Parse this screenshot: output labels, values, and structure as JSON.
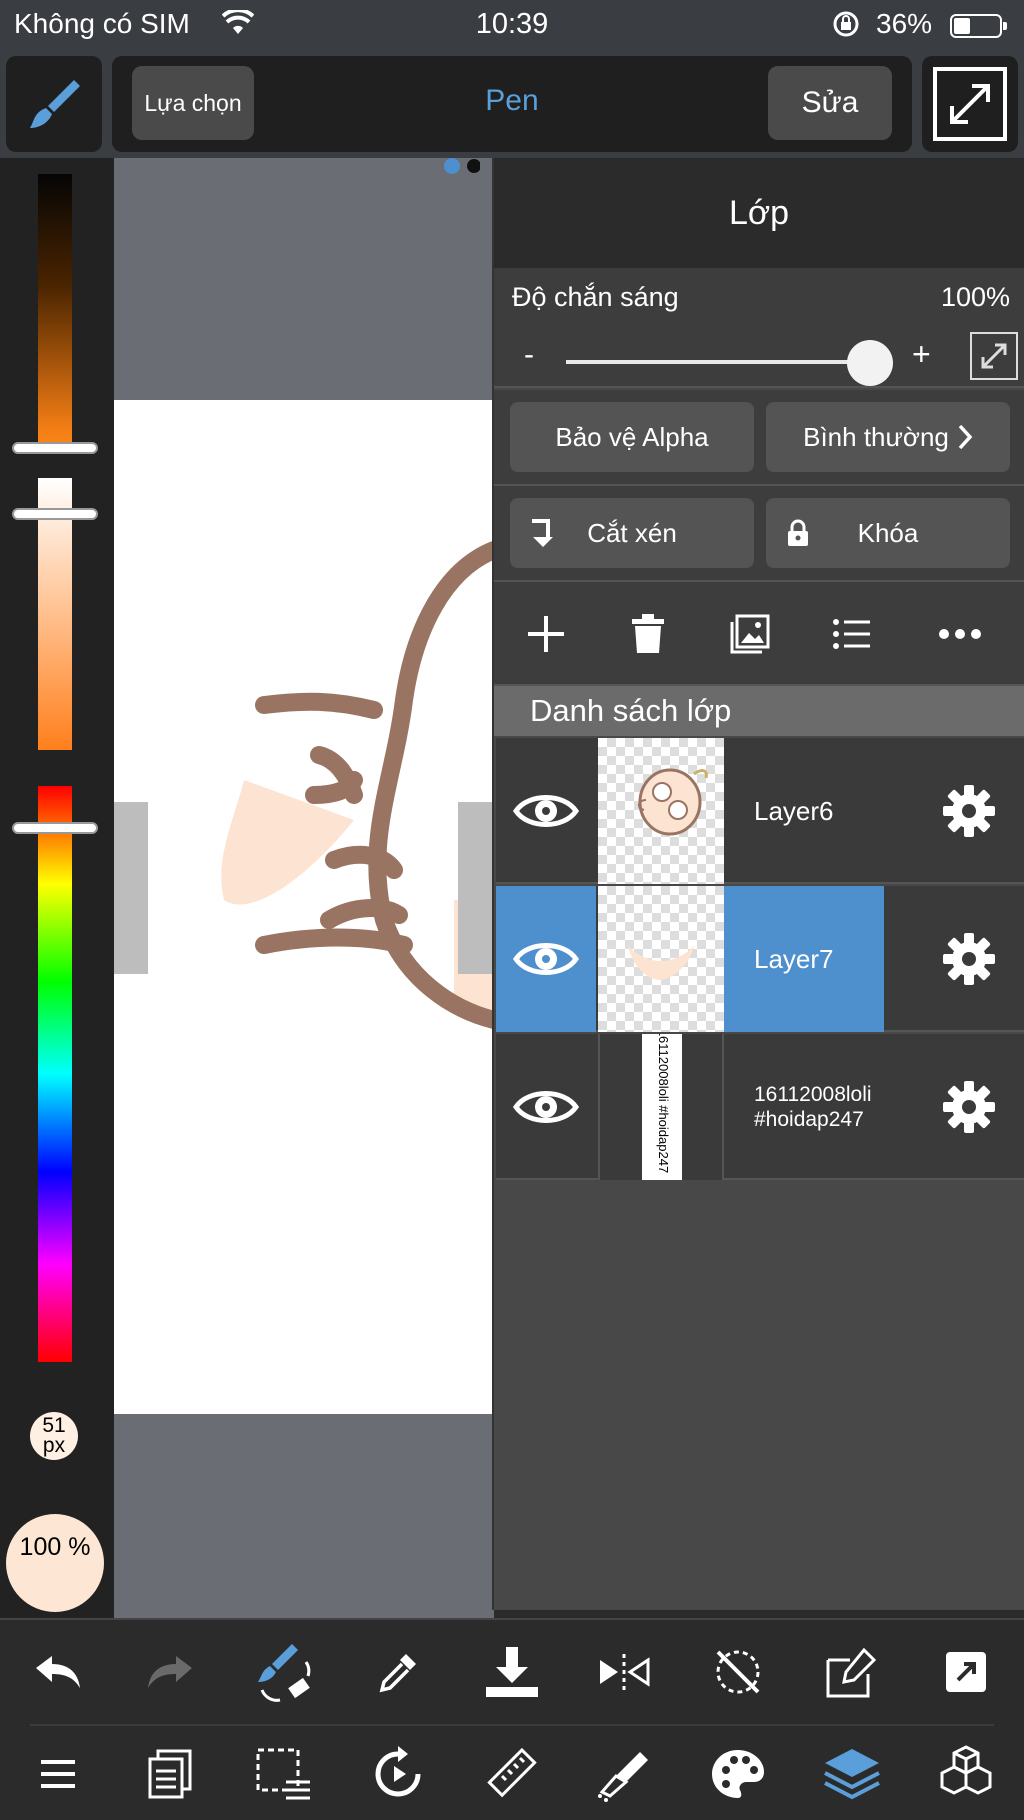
{
  "status_bar": {
    "carrier": "Không có SIM",
    "time": "10:39",
    "battery": "36%",
    "battery_level": 0.36
  },
  "toolbar": {
    "select_label": "Lựa chọn",
    "tool_name": "Pen",
    "edit_label": "Sửa"
  },
  "left_panel": {
    "brush_size": "51 px",
    "brush_opacity": "100 %"
  },
  "layer_panel": {
    "title": "Lớp",
    "opacity_label": "Độ chắn sáng",
    "opacity_value": "100%",
    "opacity_level": 1.0,
    "minus": "-",
    "plus": "+",
    "alpha_protect": "Bảo vệ Alpha",
    "blend_mode": "Bình thường",
    "clipping": "Cắt xén",
    "lock": "Khóa",
    "list_header": "Danh sách lớp",
    "layers": [
      {
        "name": "Layer6",
        "selected": false
      },
      {
        "name": "Layer7",
        "selected": true
      },
      {
        "name": "16112008loli\n#hoidap247",
        "thumb_text": "16112008loli #hoidap247",
        "selected": false
      }
    ]
  },
  "colors": {
    "accent": "#4e8fce",
    "tool_blue": "#5a9fd9",
    "panel_bg": "#484848"
  }
}
